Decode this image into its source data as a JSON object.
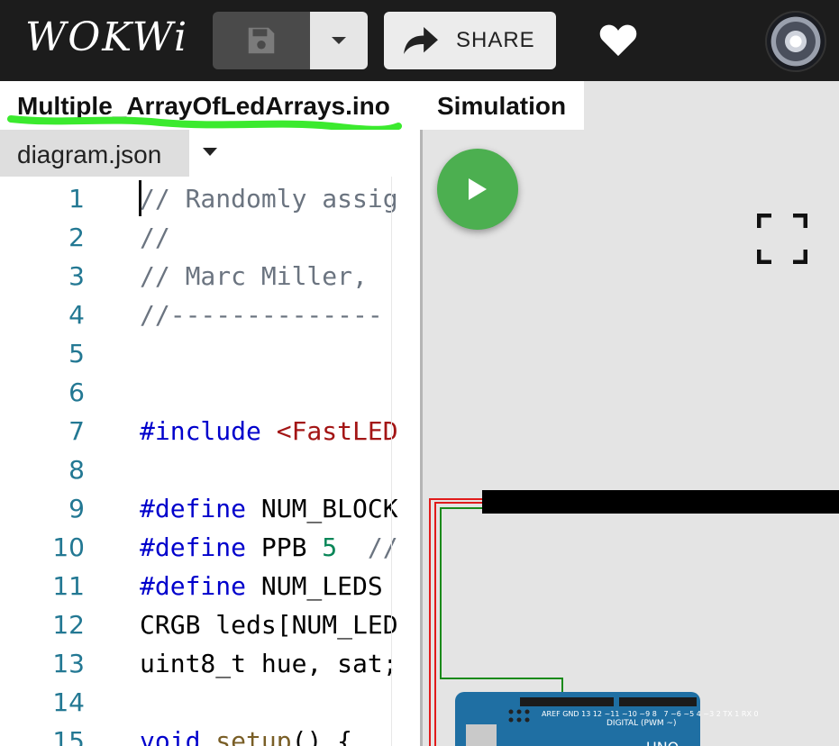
{
  "header": {
    "logo": "WOKWi",
    "save_icon": "floppy-disk-icon",
    "dropdown_icon": "chevron-down-icon",
    "share_label": "SHARE",
    "share_icon": "share-arrow-icon",
    "like_icon": "heart-icon",
    "avatar_icon": "user-avatar"
  },
  "tabs": {
    "main_file": "Multiple_ArrayOfLedArrays.ino",
    "diagram": "diagram.json",
    "simulation": "Simulation"
  },
  "editor": {
    "lines": [
      {
        "n": "1",
        "text": "// Randomly assig"
      },
      {
        "n": "2",
        "text": "//"
      },
      {
        "n": "3",
        "text": "// Marc Miller,"
      },
      {
        "n": "4",
        "text": "//--------------"
      },
      {
        "n": "5",
        "text": ""
      },
      {
        "n": "6",
        "text": ""
      },
      {
        "n": "7",
        "a": "#include ",
        "b": "<FastLED"
      },
      {
        "n": "8",
        "text": ""
      },
      {
        "n": "9",
        "a": "#define ",
        "b": "NUM_BLOCK"
      },
      {
        "n": "10",
        "a": "#define ",
        "b": "PPB ",
        "c": "5",
        "d": "  //"
      },
      {
        "n": "11",
        "a": "#define ",
        "b": "NUM_LEDS"
      },
      {
        "n": "12",
        "text": "CRGB leds[NUM_LED"
      },
      {
        "n": "13",
        "text": "uint8_t hue, sat;"
      },
      {
        "n": "14",
        "text": ""
      },
      {
        "n": "15",
        "a": "void ",
        "b": "setup",
        "c": "() {"
      }
    ]
  },
  "simulation": {
    "play_icon": "play-icon",
    "fullscreen_icon": "fullscreen-icon",
    "board_label": "UNO",
    "board_pin_text": "AREF GND 13 12 ~11 ~10 ~9 8   7 ~6 ~5 4 ~3 2 TX 1 RX 0",
    "board_digital_text": "DIGITAL (PWM ~)",
    "colors": {
      "play": "#4caf50",
      "board": "#1f6fa3",
      "wire_red": "#e01b1b",
      "wire_green": "#1a8a1a"
    }
  }
}
